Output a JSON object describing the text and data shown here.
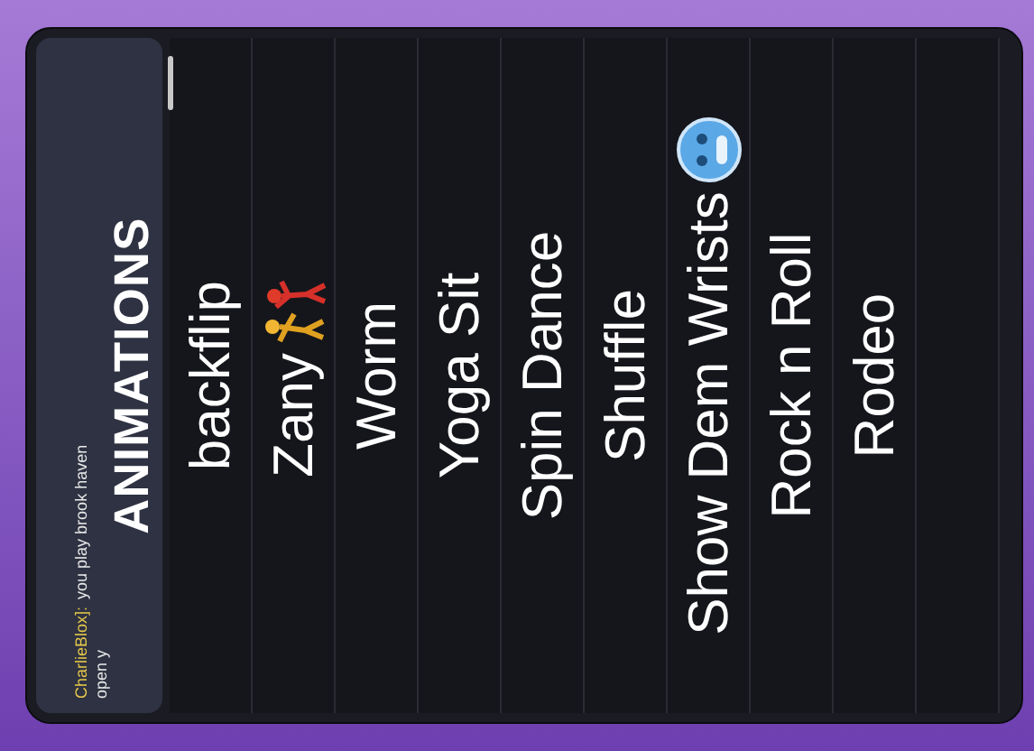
{
  "chat": [
    {
      "name": "CharlieBlox]:",
      "text": "you play brook haven"
    },
    {
      "text": "open y"
    }
  ],
  "title": "ANIMATIONS",
  "animations": [
    {
      "label": "backflip",
      "kind": "plain"
    },
    {
      "label": "Zany",
      "kind": "dancers"
    },
    {
      "label": "Worm",
      "kind": "plain"
    },
    {
      "label": "Yoga Sit",
      "kind": "plain"
    },
    {
      "label": "Spin Dance",
      "kind": "plain"
    },
    {
      "label": "Shuffle",
      "kind": "plain"
    },
    {
      "label": "Show Dem Wrists",
      "kind": "badge"
    },
    {
      "label": "Rock n Roll",
      "kind": "plain"
    },
    {
      "label": "Rodeo",
      "kind": "plain"
    },
    {
      "kind": "cut"
    }
  ]
}
